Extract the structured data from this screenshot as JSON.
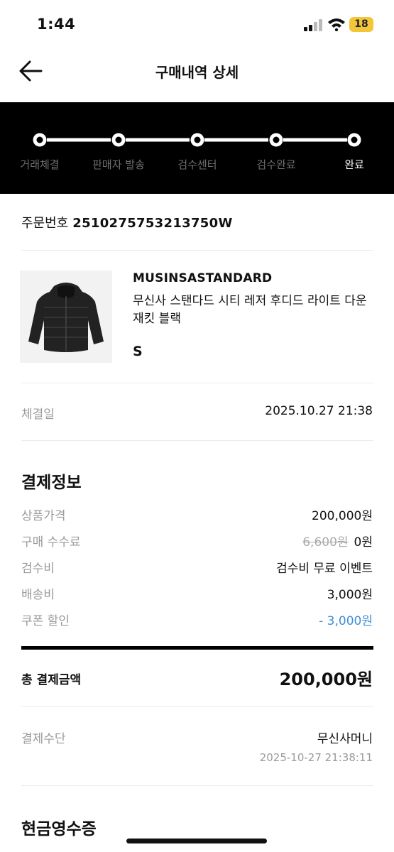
{
  "status_bar": {
    "time": "1:44",
    "battery": "18"
  },
  "header": {
    "title": "구매내역 상세"
  },
  "progress": {
    "steps": [
      "거래체결",
      "판매자 발송",
      "검수센터",
      "검수완료",
      "완료"
    ],
    "active_index": 4
  },
  "order": {
    "label": "주문번호",
    "number": "2510275753213750W"
  },
  "product": {
    "brand": "MUSINSASTANDARD",
    "name": "무신사 스탠다드 시티 레저 후디드 라이트 다운 재킷 블랙",
    "size": "S"
  },
  "contract": {
    "label": "체결일",
    "value": "2025.10.27 21:38"
  },
  "payment": {
    "title": "결제정보",
    "rows": [
      {
        "label": "상품가격",
        "value": "200,000원"
      },
      {
        "label": "구매 수수료",
        "original": "6,600원",
        "value": "0원"
      },
      {
        "label": "검수비",
        "value": "검수비 무료 이벤트"
      },
      {
        "label": "배송비",
        "value": "3,000원"
      },
      {
        "label": "쿠폰 할인",
        "value": "- 3,000원"
      }
    ],
    "total_label": "총 결제금액",
    "total_value": "200,000원"
  },
  "method": {
    "label": "결제수단",
    "value": "무신사머니",
    "timestamp": "2025-10-27 21:38:11"
  },
  "receipt": {
    "title": "현금영수증"
  },
  "colors": {
    "accent_blue": "#3e8fd8",
    "battery": "#f3c53a"
  }
}
